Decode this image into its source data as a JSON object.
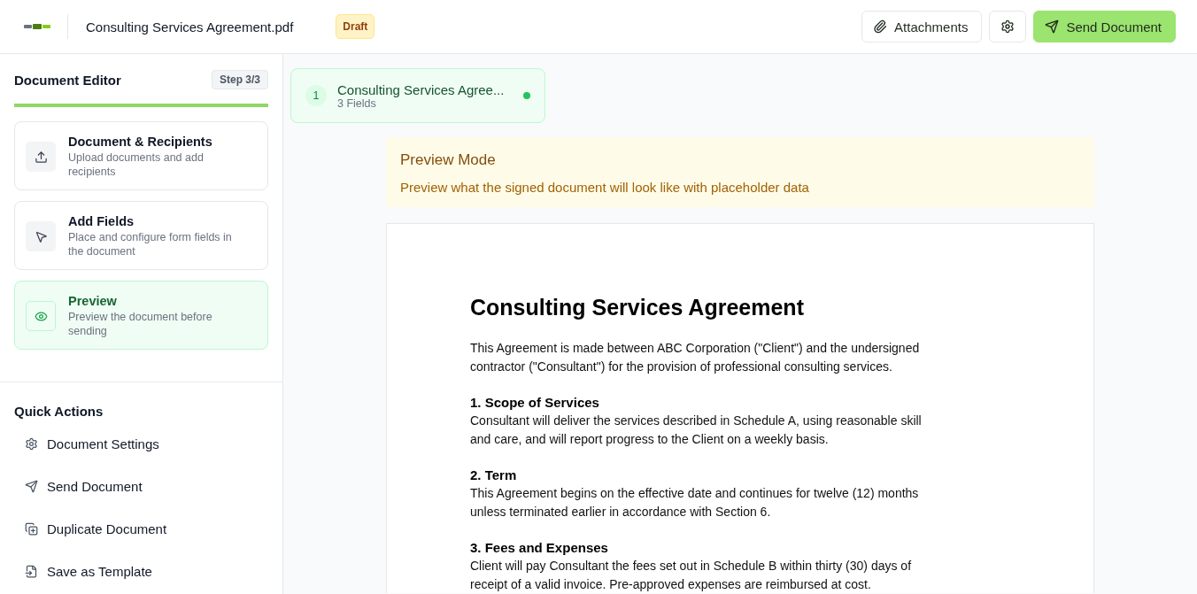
{
  "header": {
    "file_name": "Consulting Services Agreement.pdf",
    "status_badge": "Draft",
    "buttons": [
      {
        "kind": "outline",
        "label": "Attachments"
      },
      {
        "kind": "icon"
      },
      {
        "kind": "primary",
        "label": "Send Document"
      }
    ]
  },
  "sidebar": {
    "title": "Document Editor",
    "step_badge": "Step 3/3",
    "progress": {
      "level": 1
    },
    "steps": [
      {
        "title": "Document & Recipients",
        "description": "Upload documents and add recipients",
        "selected": false
      },
      {
        "title": "Add Fields",
        "description": "Place and configure form fields in the document",
        "selected": false
      },
      {
        "title": "Preview",
        "description": "Preview the document before sending",
        "selected": true
      }
    ],
    "quick_actions_title": "Quick Actions",
    "quick_actions": [
      "Document Settings",
      "Send Document",
      "Duplicate Document",
      "Save as Template"
    ]
  },
  "document_tabs": [
    {
      "number": "1",
      "name": "Consulting Services Agree...",
      "fields": "3 Fields",
      "selected": true
    }
  ],
  "preview_banner": {
    "title": "Preview Mode",
    "text": "Preview what the signed document will look like with placeholder data"
  },
  "document": {
    "title": "Consulting Services Agreement",
    "intro": "This Agreement is made between ABC Corporation (\"Client\") and the undersigned contractor (\"Consultant\") for the provision of professional consulting services.",
    "sections": [
      {
        "heading": "1. Scope of Services",
        "body": "Consultant will deliver the services described in Schedule A, using reasonable skill and care, and will report progress to the Client on a weekly basis."
      },
      {
        "heading": "2. Term",
        "body": "This Agreement begins on the effective date and continues for twelve (12) months unless terminated earlier in accordance with Section 6."
      },
      {
        "heading": "3. Fees and Expenses",
        "body": "Client will pay Consultant the fees set out in Schedule B within thirty (30) days of receipt of a valid invoice. Pre-approved expenses are reimbursed at cost."
      }
    ]
  }
}
